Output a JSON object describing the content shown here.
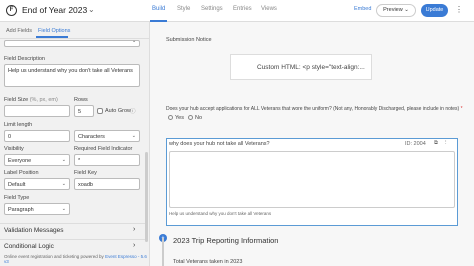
{
  "header": {
    "logo": "F",
    "form_title": "End of Year 2023",
    "nav": [
      "Build",
      "Style",
      "Settings",
      "Entries",
      "Views"
    ],
    "embed": "Embed",
    "preview": "Preview",
    "update": "Update"
  },
  "sidebar": {
    "tabs": [
      "Add Fields",
      "Field Options"
    ],
    "field_description_label": "Field Description",
    "field_description_value": "Help us understand why you don't take all Veterans",
    "field_size_label": "Field Size",
    "field_size_hint": "(%, px, em)",
    "rows_label": "Rows",
    "rows_value": "5",
    "auto_grow_label": "Auto Grow",
    "limit_length_label": "Limit length",
    "limit_value": "0",
    "limit_unit": "Characters",
    "visibility_label": "Visibility",
    "visibility_value": "Everyone",
    "required_indicator_label": "Required Field Indicator",
    "required_indicator_value": "*",
    "label_position_label": "Label Position",
    "label_position_value": "Default",
    "field_key_label": "Field Key",
    "field_key_value": "xoadb",
    "field_type_label": "Field Type",
    "field_type_value": "Paragraph",
    "section_validation": "Validation Messages",
    "section_conditional": "Conditional Logic",
    "footer_prefix": "Online event registration and ticketing powered by",
    "footer_link": "Event Espresso - 5.6 v3"
  },
  "main": {
    "submission_notice": "Submission Notice",
    "custom_html": "Custom HTML: <p style=\"text-align:...",
    "question": "Does your hub accept applications for ALL Veterans that wore the uniform? (Not any, Honorably Discharged, please include in notes)",
    "required_mark": "*",
    "options": [
      "Yes",
      "No"
    ],
    "selected_field_label": "why does your hub not take all Veterans?",
    "field_id": "ID: 2004",
    "field_help": "Help us understand why you don't take all Veterans",
    "section_title": "2023 Trip Reporting Information",
    "timeline_marker": "+",
    "next_field": "Total Veterans taken in 2023"
  },
  "colors": {
    "accent": "#3a7bd5",
    "background": "#f7f7f7"
  }
}
